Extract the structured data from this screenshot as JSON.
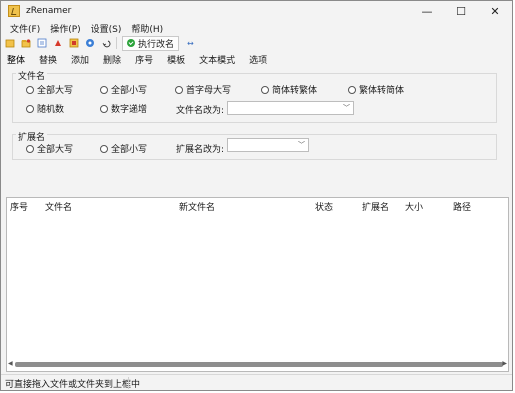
{
  "window": {
    "title": "zRenamer",
    "minimize": "—",
    "maximize": "☐",
    "close": "✕"
  },
  "menu": [
    "文件(F)",
    "操作(P)",
    "设置(S)",
    "帮助(H)"
  ],
  "toolbar": {
    "run_label": "执行改名",
    "arrow": "↔"
  },
  "tabs": [
    "整体",
    "替换",
    "添加",
    "删除",
    "序号",
    "模板",
    "文本模式",
    "选项"
  ],
  "filename_group": {
    "label": "文件名",
    "options": [
      "全部大写",
      "全部小写",
      "首字母大写",
      "简体转繁体",
      "繁体转简体",
      "随机数",
      "数字递增"
    ],
    "change_to_label": "文件名改为:",
    "change_to_value": ""
  },
  "extension_group": {
    "label": "扩展名",
    "options": [
      "全部大写",
      "全部小写"
    ],
    "change_to_label": "扩展名改为:",
    "change_to_value": ""
  },
  "list": {
    "columns": [
      "序号",
      "文件名",
      "新文件名",
      "状态",
      "扩展名",
      "大小",
      "路径"
    ]
  },
  "status": {
    "text": "可直接拖入文件或文件夹到上框中"
  }
}
